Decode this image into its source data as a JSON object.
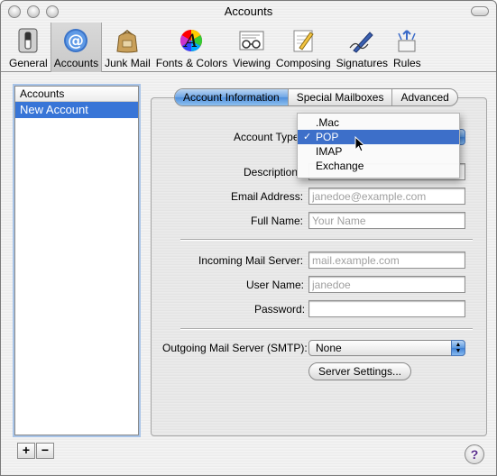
{
  "window": {
    "title": "Accounts"
  },
  "toolbar": {
    "items": [
      {
        "label": "General",
        "icon": "switch-icon"
      },
      {
        "label": "Accounts",
        "icon": "at-sign-icon",
        "selected": true
      },
      {
        "label": "Junk Mail",
        "icon": "junk-bag-icon"
      },
      {
        "label": "Fonts & Colors",
        "icon": "font-color-wheel-icon"
      },
      {
        "label": "Viewing",
        "icon": "glasses-icon"
      },
      {
        "label": "Composing",
        "icon": "pencil-paper-icon"
      },
      {
        "label": "Signatures",
        "icon": "signature-pen-icon"
      },
      {
        "label": "Rules",
        "icon": "rules-arrows-icon"
      }
    ]
  },
  "accounts": {
    "header": "Accounts",
    "items": [
      {
        "label": "New Account",
        "selected": true
      }
    ],
    "add_label": "+",
    "remove_label": "−"
  },
  "tabs": [
    {
      "label": "Account Information",
      "active": true
    },
    {
      "label": "Special Mailboxes",
      "active": false
    },
    {
      "label": "Advanced",
      "active": false
    }
  ],
  "form": {
    "account_type_label": "Account Type",
    "description_label": "Description",
    "email_label": "Email Address:",
    "email_placeholder": "janedoe@example.com",
    "fullname_label": "Full Name:",
    "fullname_placeholder": "Your Name",
    "incoming_label": "Incoming Mail Server:",
    "incoming_placeholder": "mail.example.com",
    "username_label": "User Name:",
    "username_placeholder": "janedoe",
    "password_label": "Password:",
    "password_value": "",
    "smtp_label": "Outgoing Mail Server (SMTP):",
    "smtp_value": "None",
    "server_settings_label": "Server Settings..."
  },
  "account_type_menu": {
    "options": [
      {
        "label": ".Mac",
        "checked": false,
        "highlighted": false
      },
      {
        "label": "POP",
        "checked": true,
        "highlighted": true
      },
      {
        "label": "IMAP",
        "checked": false,
        "highlighted": false
      },
      {
        "label": "Exchange",
        "checked": false,
        "highlighted": false
      }
    ],
    "check_glyph": "✓"
  },
  "help": {
    "label": "?"
  },
  "colors": {
    "selection": "#3875d7",
    "aqua_blue": "#5a98e0"
  }
}
